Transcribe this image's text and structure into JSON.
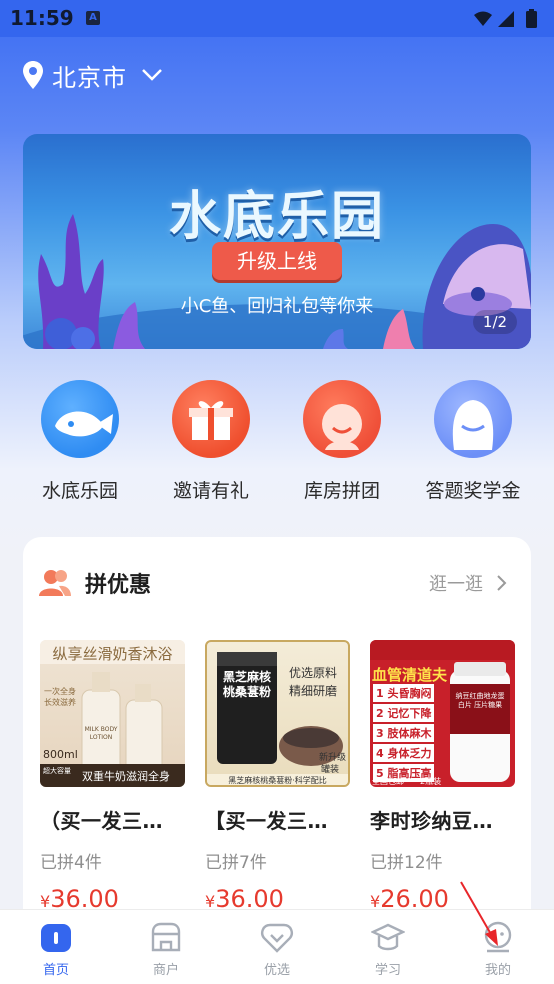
{
  "status_bar": {
    "time": "11:59",
    "notif_badge": "A"
  },
  "location": {
    "city": "北京市"
  },
  "banner": {
    "title": "水底乐园",
    "tag": "升级上线",
    "subtitle": "小C鱼、回归礼包等你来",
    "pager": "1/2"
  },
  "quick_entries": [
    {
      "label": "水底乐园",
      "icon": "fish-icon",
      "color": "#2f8cf2"
    },
    {
      "label": "邀请有礼",
      "icon": "gift-icon",
      "color": "#f0502e"
    },
    {
      "label": "库房拼团",
      "icon": "smile-face-icon",
      "color": "#ef4f38"
    },
    {
      "label": "答题奖学金",
      "icon": "mascot-icon",
      "color": "#6c8ff7"
    }
  ],
  "group_deal": {
    "title": "拼优惠",
    "more": "逛一逛",
    "products": [
      {
        "name": "（买一发三…",
        "sold": "已拼4件",
        "currency": "¥",
        "price": "36.00",
        "img_banner": "纵享丝滑奶香沐浴",
        "img_volume": "800ml",
        "img_volume_note": "超大容量",
        "img_caption": "双重牛奶滋润全身",
        "img_slogan": "一次全身 长效滋养",
        "img_bottle_label": "MILK BODY LOTION"
      },
      {
        "name": "【买一发三…",
        "sold": "已拼7件",
        "currency": "¥",
        "price": "36.00",
        "img_jar_text": "黑芝麻核桃桑葚粉",
        "img_note1": "优选原料",
        "img_note2": "精细研磨",
        "img_badge1": "新升级",
        "img_badge2": "罐装",
        "img_caption": "黑芝麻核桃桑葚粉·科学配比"
      },
      {
        "name": "李时珍纳豆…",
        "sold": "已拼12件",
        "currency": "¥",
        "price": "26.00",
        "img_headline": "血管清道夫",
        "img_points": [
          "1 头昏胸闷",
          "2 记忆下降",
          "3 肢体麻木",
          "4 身体乏力",
          "5 脂高压高"
        ],
        "img_foot1": "全国包邮",
        "img_foot2": "2瓶装",
        "img_bottle_label": "纳豆红曲地龙蛋白片 压片糖果"
      }
    ]
  },
  "tabbar": [
    {
      "label": "首页",
      "icon": "home-icon",
      "active": true
    },
    {
      "label": "商户",
      "icon": "store-icon",
      "active": false
    },
    {
      "label": "优选",
      "icon": "heart-tag-icon",
      "active": false
    },
    {
      "label": "学习",
      "icon": "graduation-cap-icon",
      "active": false
    },
    {
      "label": "我的",
      "icon": "profile-icon",
      "active": false
    }
  ],
  "colors": {
    "primary": "#3466ee",
    "price": "#e63a2e"
  }
}
